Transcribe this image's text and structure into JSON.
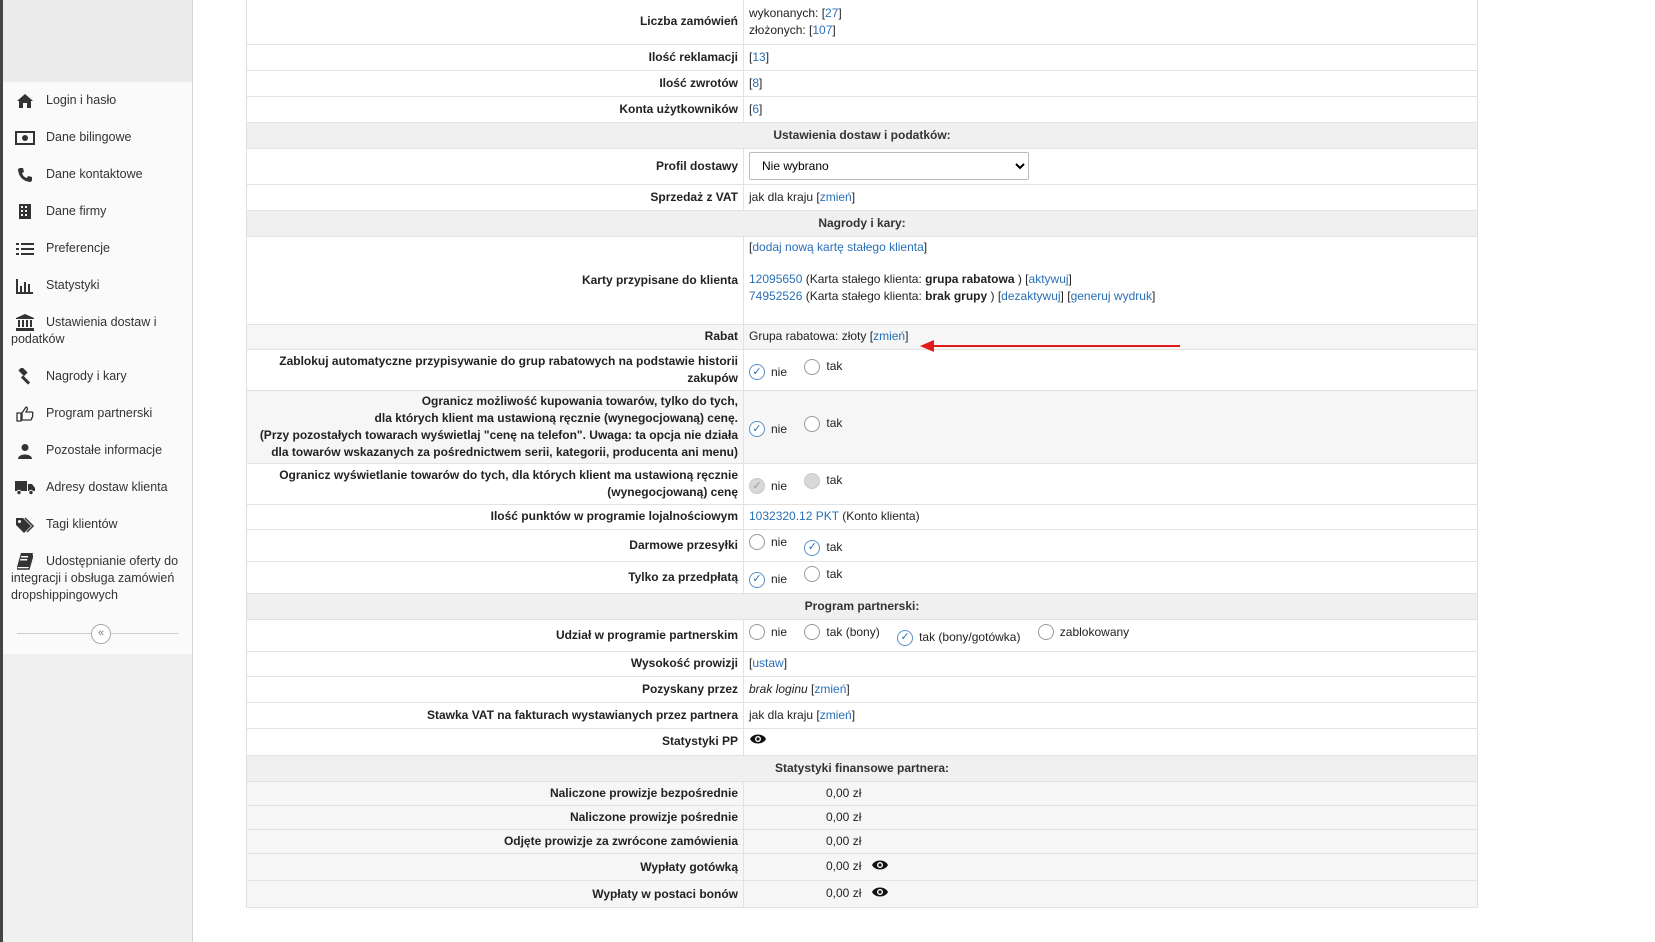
{
  "sidebar": {
    "items": [
      {
        "label": "Login i hasło",
        "icon": "home-icon"
      },
      {
        "label": "Dane bilingowe",
        "icon": "money-icon"
      },
      {
        "label": "Dane kontaktowe",
        "icon": "phone-icon"
      },
      {
        "label": "Dane firmy",
        "icon": "building-icon"
      },
      {
        "label": "Preferencje",
        "icon": "list-icon"
      },
      {
        "label": "Statystyki",
        "icon": "bar-chart-icon"
      },
      {
        "label": "Ustawienia dostaw i podatków",
        "icon": "bank-icon"
      },
      {
        "label": "Nagrody i kary",
        "icon": "gavel-icon"
      },
      {
        "label": "Program partnerski",
        "icon": "hand-pointer-icon"
      },
      {
        "label": "Pozostałe informacje",
        "icon": "user-icon"
      },
      {
        "label": "Adresy dostaw klienta",
        "icon": "truck-icon"
      },
      {
        "label": "Tagi klientów",
        "icon": "tags-icon"
      },
      {
        "label": "Udostępnianie oferty do integracji i obsługa zamówień dropshippingowych",
        "icon": "book-icon"
      }
    ],
    "collapse_symbol": "«"
  },
  "orders": {
    "label": "Liczba zamówień",
    "completed_prefix": "wykonanych: [",
    "completed": "27",
    "placed_prefix": "złożonych: [",
    "placed": "107",
    "suffix": "]"
  },
  "complaints": {
    "label": "Ilość reklamacji",
    "value": "13"
  },
  "returns": {
    "label": "Ilość zwrotów",
    "value": "8"
  },
  "user_accounts": {
    "label": "Konta użytkowników",
    "value": "6"
  },
  "delivery_section": {
    "title": "Ustawienia dostaw i podatków:"
  },
  "delivery_profile": {
    "label": "Profil dostawy",
    "selected": "Nie wybrano"
  },
  "vat_sale": {
    "label": "Sprzedaż z VAT",
    "value": "jak dla kraju",
    "link": "zmień"
  },
  "rewards_section": {
    "title": "Nagrody i kary:"
  },
  "cards": {
    "label": "Karty przypisane do klienta",
    "add_link": "dodaj nową kartę stałego klienta",
    "items": [
      {
        "number": "12095650",
        "desc_prefix": "(Karta stałego klienta: ",
        "group": "grupa rabatowa",
        "desc_suffix": " )",
        "actions": [
          "aktywuj"
        ]
      },
      {
        "number": "74952526",
        "desc_prefix": "(Karta stałego klienta: ",
        "group": "brak grupy",
        "desc_suffix": " )",
        "actions": [
          "dezaktywuj",
          "generuj wydruk"
        ]
      }
    ]
  },
  "discount": {
    "label": "Rabat",
    "value": "Grupa rabatowa: złoty",
    "link": "zmień"
  },
  "block_auto_groups": {
    "label": "Zablokuj automatyczne przypisywanie do grup rabatowych na podstawie historii zakupów",
    "options": [
      "nie",
      "tak"
    ],
    "selected": "nie"
  },
  "limit_purchase": {
    "label_lines": [
      "Ogranicz możliwość kupowania towarów, tylko do tych,",
      "dla których klient ma ustawioną ręcznie (wynegocjowaną) cenę.",
      "(Przy pozostałych towarach wyświetlaj \"cenę na telefon\". Uwaga: ta opcja nie działa",
      "dla towarów wskazanych za pośrednictwem serii, kategorii, producenta ani menu)"
    ],
    "options": [
      "nie",
      "tak"
    ],
    "selected": "nie"
  },
  "limit_display": {
    "label": "Ogranicz wyświetlanie towarów do tych, dla których klient ma ustawioną ręcznie (wynegocjowaną) cenę",
    "options": [
      "nie",
      "tak"
    ],
    "selected": "nie",
    "disabled": true
  },
  "loyalty_points": {
    "label": "Ilość punktów w programie lojalnościowym",
    "value": "1032320.12 PKT",
    "suffix": "(Konto klienta)"
  },
  "free_shipping": {
    "label": "Darmowe przesyłki",
    "options": [
      "nie",
      "tak"
    ],
    "selected": "tak"
  },
  "prepaid_only": {
    "label": "Tylko za przedpłatą",
    "options": [
      "nie",
      "tak"
    ],
    "selected": "nie"
  },
  "partner_section": {
    "title": "Program partnerski:"
  },
  "partner_participation": {
    "label": "Udział w programie partnerskim",
    "options": [
      "nie",
      "tak (bony)",
      "tak (bony/gotówka)",
      "zablokowany"
    ],
    "selected": "tak (bony/gotówka)"
  },
  "commission": {
    "label": "Wysokość prowizji",
    "link": "ustaw"
  },
  "acquired_by": {
    "label": "Pozyskany przez",
    "value": "brak loginu",
    "link": "zmień"
  },
  "partner_vat": {
    "label": "Stawka VAT na fakturach wystawianych przez partnera",
    "value": "jak dla kraju",
    "link": "zmień"
  },
  "pp_stats": {
    "label": "Statystyki PP",
    "icon": "eye-icon"
  },
  "finance_section": {
    "title": "Statystyki finansowe partnera:"
  },
  "finance": [
    {
      "label": "Naliczone prowizje bezpośrednie",
      "value": "0,00 zł",
      "eye": false
    },
    {
      "label": "Naliczone prowizje pośrednie",
      "value": "0,00 zł",
      "eye": false
    },
    {
      "label": "Odjęte prowizje za zwrócone zamówienia",
      "value": "0,00 zł",
      "eye": false
    },
    {
      "label": "Wypłaty gotówką",
      "value": "0,00 zł",
      "eye": true
    },
    {
      "label": "Wypłaty w postaci bonów",
      "value": "0,00 zł",
      "eye": true
    }
  ],
  "colors": {
    "link": "#2a6fb5",
    "arrow": "#e01b1b",
    "section_bg": "#f0f0f0"
  }
}
